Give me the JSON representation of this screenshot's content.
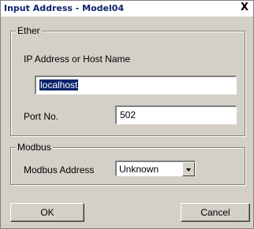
{
  "window": {
    "title": "Input Address - Model04",
    "close_label": "X"
  },
  "ether": {
    "legend": "Ether",
    "host_label": "IP Address or Host Name",
    "host_value": "localhost",
    "port_label": "Port No.",
    "port_value": "502"
  },
  "modbus": {
    "legend": "Modbus",
    "address_label": "Modbus Address",
    "address_value": "Unknown"
  },
  "buttons": {
    "ok": "OK",
    "cancel": "Cancel"
  }
}
